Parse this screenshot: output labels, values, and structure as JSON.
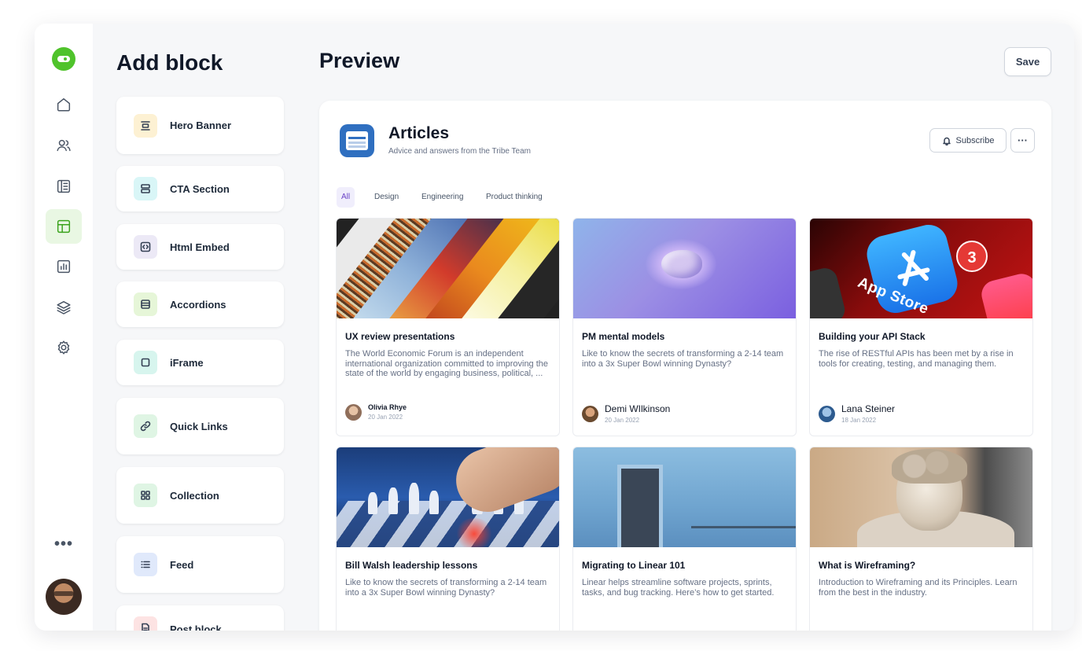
{
  "blocks_panel": {
    "title": "Add block",
    "items": [
      {
        "label": "Hero Banner",
        "icon": "hero-banner-icon",
        "color": "#fdf1d3"
      },
      {
        "label": "CTA Section",
        "icon": "cta-section-icon",
        "color": "#d9f6f7"
      },
      {
        "label": "Html Embed",
        "icon": "code-icon",
        "color": "#ece9f6"
      },
      {
        "label": "Accordions",
        "icon": "accordion-icon",
        "color": "#e6f6d8"
      },
      {
        "label": "iFrame",
        "icon": "iframe-icon",
        "color": "#d7f5ee"
      },
      {
        "label": "Quick Links",
        "icon": "link-icon",
        "color": "#dff5e4"
      },
      {
        "label": "Collection",
        "icon": "grid-icon",
        "color": "#dff5e4"
      },
      {
        "label": "Feed",
        "icon": "list-icon",
        "color": "#e0e9fb"
      },
      {
        "label": "Post block",
        "icon": "document-icon",
        "color": "#fde3e3"
      }
    ]
  },
  "rail": {
    "items": [
      "home-icon",
      "members-icon",
      "content-icon",
      "layout-icon",
      "analytics-icon",
      "layers-icon",
      "settings-icon"
    ],
    "active": "layout-icon",
    "more_label": "•••"
  },
  "preview": {
    "title": "Preview",
    "save_label": "Save",
    "space": {
      "title": "Articles",
      "subtitle": "Advice and answers from the Tribe Team",
      "subscribe_label": "Subscribe",
      "more_label": "···"
    },
    "tabs": [
      "All",
      "Design",
      "Engineering",
      "Product thinking"
    ],
    "active_tab": "All",
    "cards": [
      {
        "title": "UX review presentations",
        "description": "The World Economic Forum is an independent international organization committed to improving the state of the world by engaging business, political, ...",
        "author": "Olivia Rhye",
        "date": "20 Jan 2022"
      },
      {
        "title": "PM mental models",
        "description": "Like to know the secrets of transforming a 2-14 team into a 3x Super Bowl winning Dynasty?",
        "author": "Demi WIlkinson",
        "date": "20 Jan 2022"
      },
      {
        "title": "Building your API Stack",
        "description": "The rise of RESTful APIs has been met by a rise in tools for creating, testing, and managing them.",
        "author": "Lana Steiner",
        "date": "18 Jan 2022",
        "image_text": "App Store",
        "badge": "3"
      },
      {
        "title": "Bill Walsh leadership lessons",
        "description": "Like to know the secrets of transforming a 2-14 team into a 3x Super Bowl winning Dynasty?"
      },
      {
        "title": "Migrating to Linear 101",
        "description": "Linear helps streamline software projects, sprints, tasks, and bug tracking. Here’s how to get started."
      },
      {
        "title": "What is Wireframing?",
        "description": "Introduction to Wireframing and its Principles. Learn from the best in the industry."
      }
    ]
  },
  "colors": {
    "accent_green": "#4fc32b",
    "active_tab": "#6941c6",
    "brand_blue": "#2f6fc0"
  }
}
